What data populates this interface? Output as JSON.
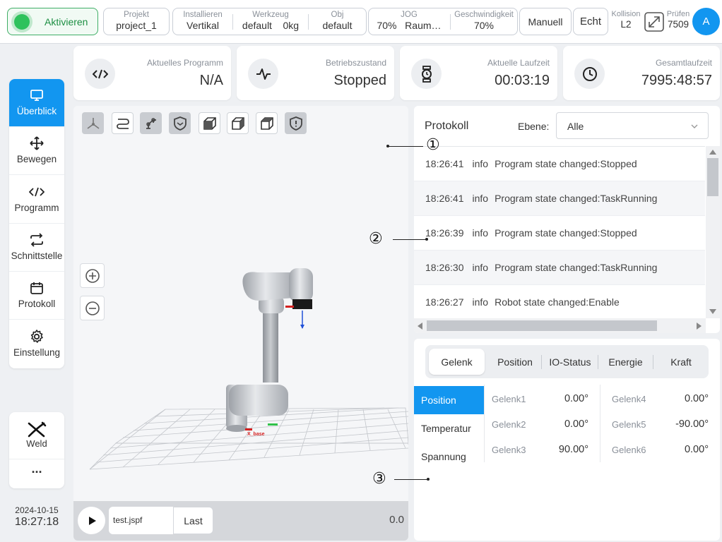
{
  "topbar": {
    "activate_label": "Aktivieren",
    "project_label": "Projekt",
    "project_value": "project_1",
    "install_label": "Installieren",
    "install_value": "Vertikal",
    "tool_label": "Werkzeug",
    "tool_value": "default",
    "tool_weight": "0kg",
    "obj_label": "Obj",
    "obj_value": "default",
    "jog_label": "JOG",
    "jog_value": "70%",
    "jog_space": "Raum…",
    "speed_label": "Geschwindigkeit",
    "speed_value": "70%",
    "manual_label": "Manuell",
    "real_label": "Echt",
    "collision_label": "Kollision",
    "collision_value": "L2",
    "check_label": "Prüfen",
    "check_value": "7509",
    "avatar_letter": "A"
  },
  "sidebar": {
    "items": [
      {
        "label": "Überblick",
        "icon": "monitor-icon"
      },
      {
        "label": "Bewegen",
        "icon": "move-arrows-icon"
      },
      {
        "label": "Programm",
        "icon": "code-icon"
      },
      {
        "label": "Schnittstelle",
        "icon": "swap-arrows-icon"
      },
      {
        "label": "Protokoll",
        "icon": "calendar-icon"
      },
      {
        "label": "Einstellung",
        "icon": "gear-icon"
      }
    ],
    "weld_label": "Weld",
    "more_label": "···",
    "date": "2024-10-15",
    "time": "18:27:18"
  },
  "cards": [
    {
      "label": "Aktuelles Programm",
      "value": "N/A",
      "icon": "code-icon"
    },
    {
      "label": "Betriebszustand",
      "value": "Stopped",
      "icon": "pulse-icon"
    },
    {
      "label": "Aktuelle Laufzeit",
      "value": "00:03:19",
      "icon": "watch-icon"
    },
    {
      "label": "Gesamtlaufzeit",
      "value": "7995:48:57",
      "icon": "clock-icon"
    }
  ],
  "view": {
    "file_name": "test.jspf",
    "last_label": "Last",
    "speed_readout": "0.0",
    "axis_x_label": "X_base"
  },
  "protocol": {
    "title": "Protokoll",
    "level_label": "Ebene:",
    "level_value": "Alle",
    "entries": [
      {
        "time": "18:26:41",
        "level": "info",
        "message": "Program state changed:Stopped"
      },
      {
        "time": "18:26:41",
        "level": "info",
        "message": "Program state changed:TaskRunning"
      },
      {
        "time": "18:26:39",
        "level": "info",
        "message": "Program state changed:Stopped"
      },
      {
        "time": "18:26:30",
        "level": "info",
        "message": "Program state changed:TaskRunning"
      },
      {
        "time": "18:26:27",
        "level": "info",
        "message": "Robot state changed:Enable"
      }
    ]
  },
  "joints": {
    "tabs": [
      "Gelenk",
      "Position",
      "IO-Status",
      "Energie",
      "Kraft"
    ],
    "side_tabs": [
      "Position",
      "Temperatur",
      "Spannung"
    ],
    "values": [
      {
        "name": "Gelenk1",
        "value": "0.00°"
      },
      {
        "name": "Gelenk2",
        "value": "0.00°"
      },
      {
        "name": "Gelenk3",
        "value": "90.00°"
      },
      {
        "name": "Gelenk4",
        "value": "0.00°"
      },
      {
        "name": "Gelenk5",
        "value": "-90.00°"
      },
      {
        "name": "Gelenk6",
        "value": "0.00°"
      }
    ]
  },
  "callouts": [
    "①",
    "②",
    "③"
  ],
  "colors": {
    "accent": "#1296f0",
    "active_green": "#2ec25c"
  }
}
